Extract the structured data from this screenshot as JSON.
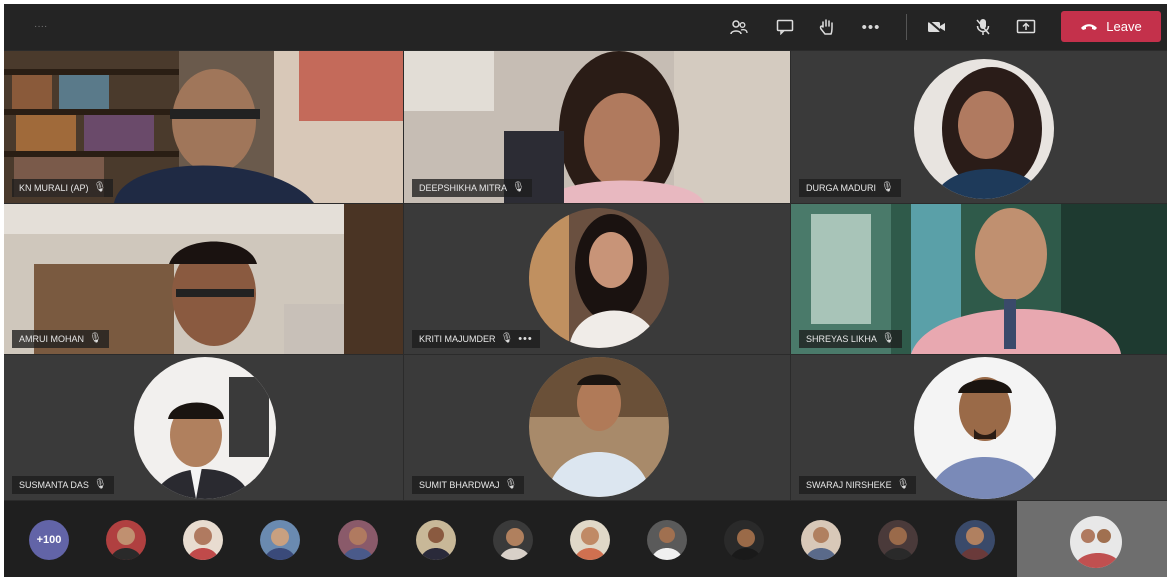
{
  "call": {
    "timer": "····",
    "leave_label": "Leave",
    "toolbar_icons": [
      "participants-icon",
      "chat-icon",
      "raise-hand-icon",
      "more-options-icon",
      "camera-icon",
      "microphone-icon",
      "share-screen-icon"
    ]
  },
  "participants": [
    {
      "name": "KN Murali (AP)"
    },
    {
      "name": "DEEPSHIKHA MITRA"
    },
    {
      "name": "DURGA MADURI"
    },
    {
      "name": "AMRUI MOHAN"
    },
    {
      "name": "KRITI MAJUMDER"
    },
    {
      "name": "SHREYAS LIKHA"
    },
    {
      "name": "SUSMANTA DAS"
    },
    {
      "name": "SUMIT BHARDWAJ"
    },
    {
      "name": "SWARAJ NIRSHEKE"
    }
  ],
  "roster_strip": {
    "overflow_count": "+100"
  },
  "colors": {
    "leave": "#c4314b",
    "overflow_badge": "#6264a7",
    "stage": "#2b2b2b"
  }
}
